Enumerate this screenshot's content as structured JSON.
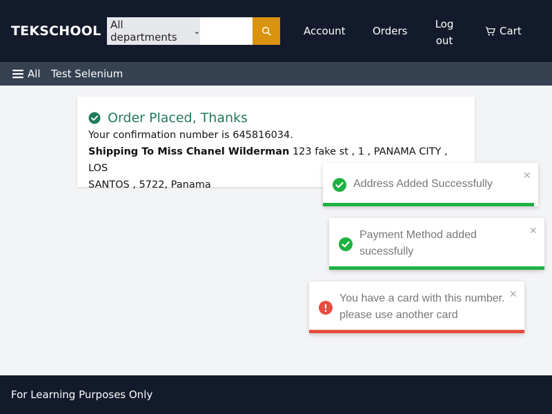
{
  "header": {
    "logo": "TEKSCHOOL",
    "department_select": "All departments",
    "search_value": "",
    "account": "Account",
    "orders": "Orders",
    "logout_line1": "Log",
    "logout_line2": "out",
    "cart": "Cart"
  },
  "subnav": {
    "all_label": "All",
    "items": [
      "Test Selenium"
    ]
  },
  "order": {
    "title": "Order Placed, Thanks",
    "confirmation_text": "Your confirmation number is 645816034.",
    "shipping_label": "Shipping To Miss Chanel Wilderman",
    "address_line1": " 123 fake st , 1 , PANAMA CITY , LOS",
    "address_line2": "SANTOS , 5722, Panama"
  },
  "toasts": [
    {
      "type": "success",
      "line1": "Address Added Successfully",
      "line2": "",
      "color": "#1fb141"
    },
    {
      "type": "success",
      "line1": "Payment Method added",
      "line2": "sucessfully",
      "color": "#1fb141"
    },
    {
      "type": "error",
      "line1": "You have a card with this number.",
      "line2": "please use another card",
      "color": "#e74c3c"
    }
  ],
  "footer": {
    "text": "For Learning Purposes Only"
  },
  "colors": {
    "navbar": "#131a2b",
    "subnav": "#364152",
    "search_button": "#d9930f",
    "order_title": "#1f7a5c"
  }
}
